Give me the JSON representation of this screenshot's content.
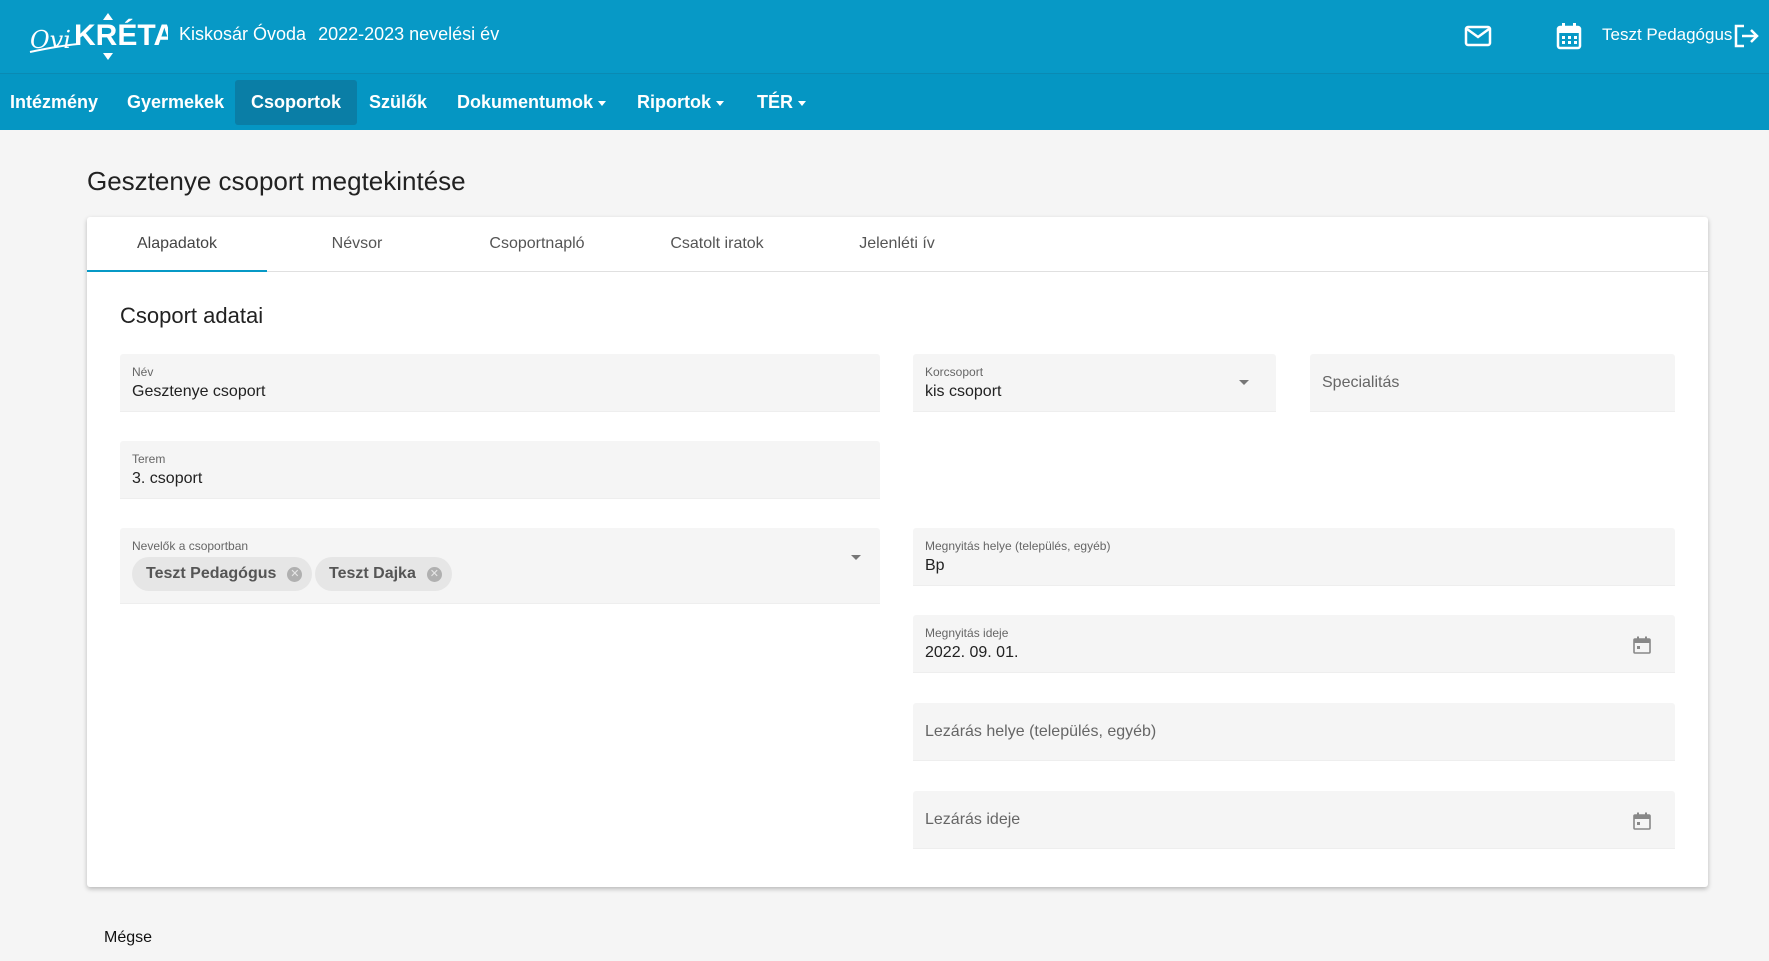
{
  "header": {
    "logo_text": "OviKRÉTA",
    "school_name": "Kiskosár Óvoda",
    "school_year": "2022-2023 nevelési év",
    "user_name": "Teszt Pedagógus",
    "icons": [
      "mail-icon",
      "calendar-icon",
      "logout-icon"
    ]
  },
  "nav": {
    "items": [
      {
        "label": "Intézmény"
      },
      {
        "label": "Gyermekek"
      },
      {
        "label": "Csoportok",
        "active": true
      },
      {
        "label": "Szülők"
      },
      {
        "label": "Dokumentumok",
        "dropdown": true
      },
      {
        "label": "Riportok",
        "dropdown": true
      },
      {
        "label": "TÉR",
        "dropdown": true
      }
    ]
  },
  "page": {
    "title": "Gesztenye csoport megtekintése"
  },
  "tabs": [
    {
      "label": "Alapadatok",
      "active": true
    },
    {
      "label": "Névsor"
    },
    {
      "label": "Csoportnapló"
    },
    {
      "label": "Csatolt iratok"
    },
    {
      "label": "Jelenléti ív"
    }
  ],
  "form": {
    "section_title": "Csoport adatai",
    "nev": {
      "label": "Név",
      "value": "Gesztenye csoport"
    },
    "korcsoport": {
      "label": "Korcsoport",
      "value": "kis csoport"
    },
    "specialitas": {
      "placeholder": "Specialitás"
    },
    "terem": {
      "label": "Terem",
      "value": "3. csoport"
    },
    "nevelok": {
      "label": "Nevelők a csoportban",
      "chips": [
        "Teszt Pedagógus",
        "Teszt Dajka"
      ]
    },
    "megnyitas_helye": {
      "label": "Megnyitás helye (település, egyéb)",
      "value": "Bp"
    },
    "megnyitas_ideje": {
      "label": "Megnyitás ideje",
      "value": "2022. 09. 01."
    },
    "lezaras_helye": {
      "placeholder": "Lezárás helye (település, egyéb)"
    },
    "lezaras_ideje": {
      "placeholder": "Lezárás ideje"
    }
  },
  "actions": {
    "cancel_label": "Mégse"
  },
  "colors": {
    "header_bg": "#0799c6",
    "nav_active_bg": "#0a7ea6",
    "field_bg": "#f5f5f5",
    "tab_indicator": "#0799c6"
  }
}
